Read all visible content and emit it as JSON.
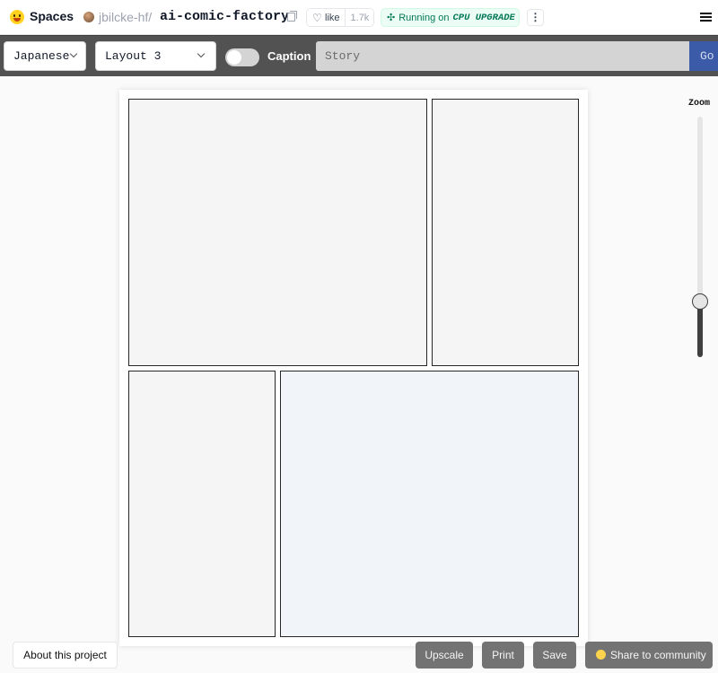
{
  "header": {
    "spaces_label": "Spaces",
    "owner": "jbilcke-hf/",
    "repo": "ai-comic-factory",
    "like_label": "like",
    "like_count": "1.7k",
    "status_prefix": "Running on",
    "status_hardware": "CPU UPGRADE"
  },
  "toolbar": {
    "language": "Japanese",
    "layout": "Layout 3",
    "caption_label": "Caption",
    "caption_enabled": false,
    "story_placeholder": "Story",
    "go_label": "Go"
  },
  "comic": {
    "panels": [
      "panel-1",
      "panel-2",
      "panel-3",
      "panel-4"
    ]
  },
  "zoom": {
    "label": "Zoom",
    "value_fraction": 0.23
  },
  "footer": {
    "about_label": "About this project",
    "upscale_label": "Upscale",
    "print_label": "Print",
    "save_label": "Save",
    "share_label": "Share to community"
  },
  "colors": {
    "toolbar_bg": "#525252",
    "go_button": "#3b5ba8",
    "running_green": "#047857",
    "action_button": "#737373"
  }
}
